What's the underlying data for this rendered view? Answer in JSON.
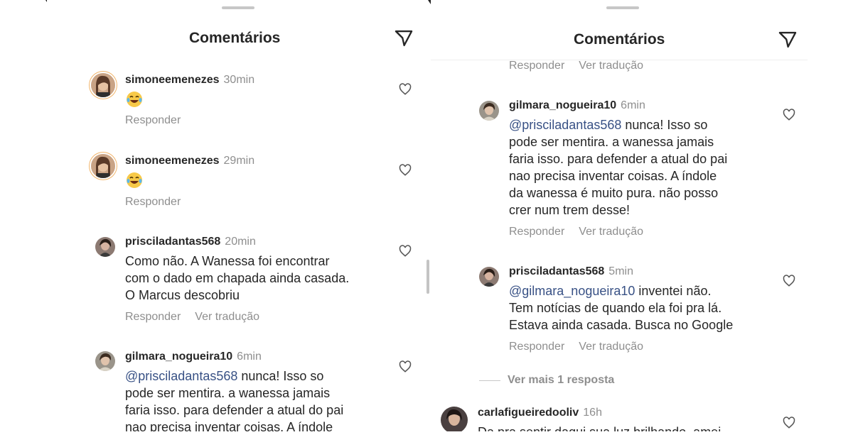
{
  "left": {
    "title": "Comentários",
    "comments": [
      {
        "user": "simoneemenezes",
        "time": "30min",
        "emoji": "laughing-tears",
        "actions": [
          "Responder"
        ]
      },
      {
        "user": "simoneemenezes",
        "time": "29min",
        "emoji": "laughing-tears",
        "actions": [
          "Responder"
        ]
      },
      {
        "user": "prisciladantas568",
        "time": "20min",
        "text": "Como não. A Wanessa foi encontrar\ncom o dado em chapada ainda casada.\nO Marcus descobriu",
        "actions": [
          "Responder",
          "Ver tradução"
        ]
      },
      {
        "user": "gilmara_nogueira10",
        "time": "6min",
        "mention": "@prisciladantas568",
        "text": " nunca! Isso so\npode ser mentira. a wanessa jamais\nfaria isso. para defender a atual do pai\nnao precisa inventar coisas. A índole"
      }
    ]
  },
  "right": {
    "title": "Comentários",
    "top_actions": [
      "Responder",
      "Ver tradução"
    ],
    "comments": [
      {
        "user": "gilmara_nogueira10",
        "time": "6min",
        "mention": "@prisciladantas568",
        "text": " nunca! Isso so\npode ser mentira. a wanessa jamais\nfaria isso. para defender a atual do pai\nnao precisa inventar coisas. A índole\nda wanessa é muito pura. não posso\ncrer num trem desse!",
        "actions": [
          "Responder",
          "Ver tradução"
        ]
      },
      {
        "user": "prisciladantas568",
        "time": "5min",
        "mention": "@gilmara_nogueira10",
        "text": " inventei não.\nTem notícias de quando ela foi pra lá.\nEstava ainda casada. Busca no Google",
        "actions": [
          "Responder",
          "Ver tradução"
        ]
      },
      {
        "user": "carlafigueiredooliv",
        "time": "16h",
        "text": "Da pra sentir daqui sua luz brilhando, amei"
      }
    ],
    "view_more": "Ver mais 1 resposta"
  },
  "colors": {
    "text": "#262626",
    "muted": "#8e8e8e",
    "mention": "#385185",
    "background": "#ffffff"
  }
}
